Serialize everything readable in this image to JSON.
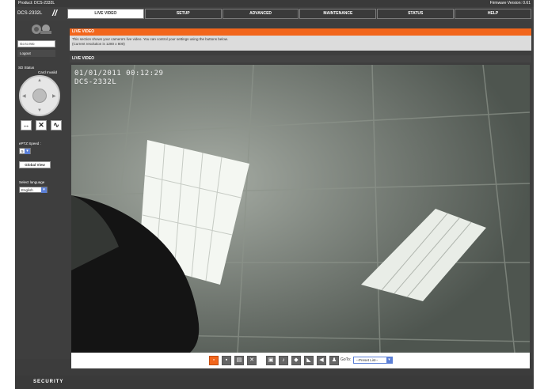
{
  "topbar": {
    "product": "Product: DCS-2332L",
    "firmware": "Firmware Version: 0.61"
  },
  "header": {
    "model": "DCS-2332L",
    "slashes": "//"
  },
  "tabs": [
    {
      "label": "LIVE VIDEO",
      "active": true
    },
    {
      "label": "SETUP",
      "active": false
    },
    {
      "label": "ADVANCED",
      "active": false
    },
    {
      "label": "MAINTENANCE",
      "active": false
    },
    {
      "label": "STATUS",
      "active": false
    },
    {
      "label": "HELP",
      "active": false
    }
  ],
  "sidebar": {
    "user_label": "Go to Mo",
    "logout_label": "Logout",
    "sd_status": "SD Status",
    "card_status": "Card Invalid",
    "ptz_speed_label": "ePTZ Speed :",
    "ptz_speed_value": "5",
    "global_view": "Global View",
    "language_label": "Select language",
    "language_value": "English"
  },
  "main": {
    "section_title": "LIVE VIDEO",
    "info_line1": "This section shows your camera's live video. You can control your settings using the buttons below.",
    "info_line2": "(Current resolution is 1280 x 800)",
    "live_video_title": "LIVE VIDEO",
    "osd_datetime": "01/01/2011 00:12:29",
    "osd_name": "DCS-2332L"
  },
  "controls": {
    "goto_label": "GoTo:",
    "preset_value": "--Preset List--",
    "icons": [
      "snapshot-icon",
      "record-icon",
      "storage-icon",
      "fullscreen-icon",
      "digital-zoom-icon",
      "listen-icon",
      "talk-icon",
      "audio-icon",
      "volume-icon",
      "mic-icon"
    ]
  },
  "footer": {
    "label": "SECURITY"
  },
  "colors": {
    "accent": "#f2661c",
    "dark": "#3c3c3c",
    "select": "#5b7fd6"
  }
}
